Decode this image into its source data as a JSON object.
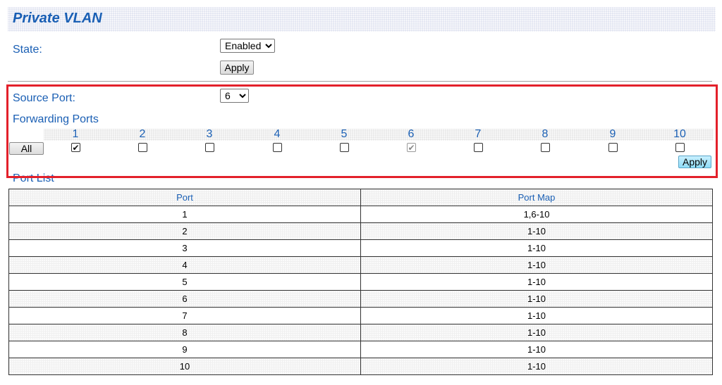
{
  "page": {
    "title": "Private VLAN"
  },
  "state": {
    "label": "State:",
    "selected": "Enabled",
    "apply_label": "Apply"
  },
  "source_port": {
    "label": "Source Port:",
    "selected": "6"
  },
  "forwarding": {
    "label": "Forwarding Ports",
    "all_label": "All",
    "apply_label": "Apply",
    "ports": [
      {
        "number": "1",
        "checked": true,
        "disabled": false
      },
      {
        "number": "2",
        "checked": false,
        "disabled": false
      },
      {
        "number": "3",
        "checked": false,
        "disabled": false
      },
      {
        "number": "4",
        "checked": false,
        "disabled": false
      },
      {
        "number": "5",
        "checked": false,
        "disabled": false
      },
      {
        "number": "6",
        "checked": true,
        "disabled": true
      },
      {
        "number": "7",
        "checked": false,
        "disabled": false
      },
      {
        "number": "8",
        "checked": false,
        "disabled": false
      },
      {
        "number": "9",
        "checked": false,
        "disabled": false
      },
      {
        "number": "10",
        "checked": false,
        "disabled": false
      }
    ]
  },
  "port_list": {
    "label": "Port List",
    "columns": [
      "Port",
      "Port Map"
    ],
    "rows": [
      [
        "1",
        "1,6-10"
      ],
      [
        "2",
        "1-10"
      ],
      [
        "3",
        "1-10"
      ],
      [
        "4",
        "1-10"
      ],
      [
        "5",
        "1-10"
      ],
      [
        "6",
        "1-10"
      ],
      [
        "7",
        "1-10"
      ],
      [
        "8",
        "1-10"
      ],
      [
        "9",
        "1-10"
      ],
      [
        "10",
        "1-10"
      ]
    ]
  },
  "colors": {
    "text_blue": "#1a5fb4",
    "highlight_red": "#e3202a",
    "apply_blue": "#8fdcf8"
  }
}
